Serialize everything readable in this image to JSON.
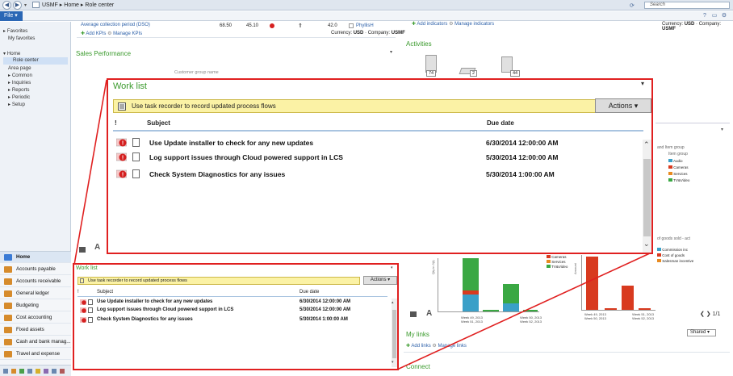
{
  "address_bar": {
    "company": "USMF",
    "path": [
      "Home",
      "Role center"
    ],
    "search_placeholder": "Search"
  },
  "menu": {
    "file_label": "File"
  },
  "nav": {
    "favorites_header": "Favorites",
    "favorites": [
      "My favorites"
    ],
    "home_header": "Home",
    "home_items": [
      "Role center",
      "Area page",
      "Common",
      "Inquiries",
      "Reports",
      "Periodic",
      "Setup"
    ],
    "modules": [
      "Home",
      "Accounts payable",
      "Accounts receivable",
      "General ledger",
      "Budgeting",
      "Cost accounting",
      "Fixed assets",
      "Cash and bank manag...",
      "Travel and expense"
    ]
  },
  "kpi": {
    "row_label": "Average collection period (DSO)",
    "values": [
      "68.50",
      "45.10",
      "42.0"
    ],
    "person": "PhyllisH",
    "add_kpis": "Add KPIs",
    "manage_kpis": "Manage KPIs",
    "currency_label": "Currency:",
    "currency": "USD",
    "company_label": "Company:",
    "company": "USMF"
  },
  "indicators": {
    "add": "Add indicators",
    "manage": "Manage indicators",
    "currency_label": "Currency:",
    "currency": "USD",
    "company_label": "Company:",
    "company": "USMF"
  },
  "activities": {
    "title": "Activities",
    "counts": [
      "74",
      "2",
      "44"
    ]
  },
  "sales_performance": {
    "title": "Sales Performance",
    "customer_group_label": "Customer group name"
  },
  "work_list": {
    "title": "Work list",
    "banner": "Use task recorder to record updated process flows",
    "actions_label": "Actions",
    "col_flag": "!",
    "col_subject": "Subject",
    "col_due": "Due date",
    "rows": [
      {
        "subject": "Use Update installer to check for any new updates",
        "due": "6/30/2014 12:00:00 AM"
      },
      {
        "subject": "Log support issues through Cloud powered support in LCS",
        "due": "5/30/2014 12:00:00 AM"
      },
      {
        "subject": "Check System Diagnostics for any issues",
        "due": "5/30/2014 1:00:00 AM"
      }
    ]
  },
  "charts_area": {
    "item_group_label": "Item group",
    "item_legend": [
      "Audio",
      "Cameras",
      "Services",
      "TV&Video"
    ],
    "legend_colors": [
      "#3aa0c8",
      "#d83a1f",
      "#e88b20",
      "#3aa843"
    ],
    "mid_legend": [
      "Cameras",
      "Services",
      "TV&Video"
    ],
    "goods_label": "of goods sold - act",
    "right_legend": [
      "Commission inc",
      "Cost of goods",
      "Salesman incentive"
    ],
    "axis_left": "Qty in 3(t)",
    "axis_right": "Amount",
    "weeks_left": [
      "Week 49, 2013",
      "Week 50, 2013",
      "Week 51, 2013",
      "Week 52, 2013"
    ],
    "weeks_right": [
      "Week 49, 2013",
      "Week 50, 2013",
      "Week 51, 2013",
      "Week 52, 2013"
    ],
    "pager": "1/1"
  },
  "my_links": {
    "title": "My links",
    "share_value": "Shared",
    "add_links": "Add links",
    "manage_links": "Manage links"
  },
  "connect": {
    "title": "Connect"
  },
  "tool_letter": "A"
}
